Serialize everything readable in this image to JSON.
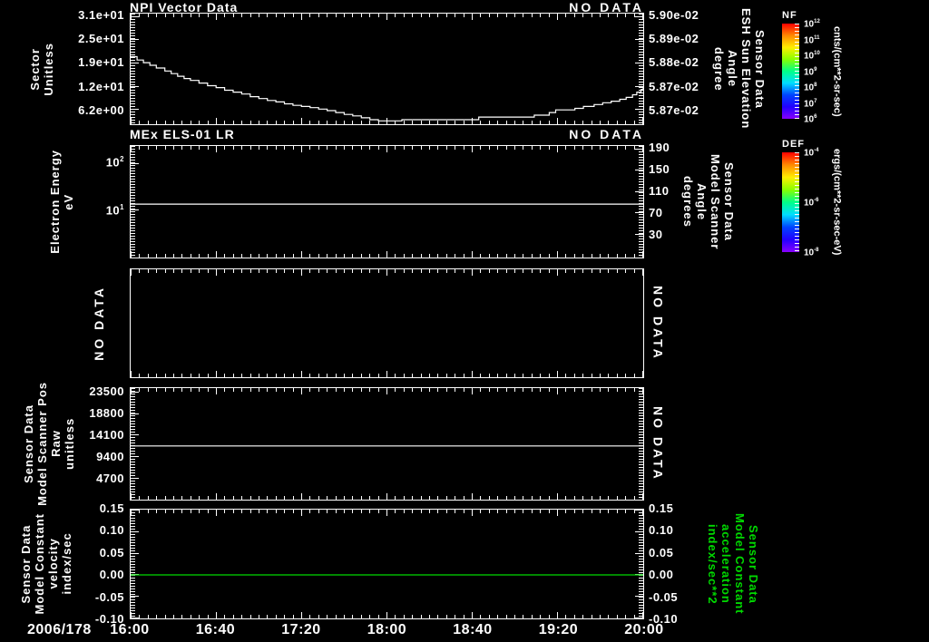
{
  "colors": {
    "background": "#000000",
    "foreground": "#ffffff",
    "green": "#00d900"
  },
  "footer": {
    "date_label": "2006/178",
    "time_ticks": [
      "16:00",
      "16:40",
      "17:20",
      "18:00",
      "18:40",
      "19:20",
      "20:00"
    ]
  },
  "colorbars": [
    {
      "title": "NF",
      "unit": "cnts/(cm**2-sr-sec)",
      "ticks": [
        "10^12",
        "10^11",
        "10^10",
        "10^9",
        "10^8",
        "10^7",
        "10^6"
      ],
      "gradient": [
        "#ff0000",
        "#ff8800",
        "#ffee00",
        "#88ff00",
        "#00ff88",
        "#00ddff",
        "#0044ff",
        "#2200ff",
        "#8800ff"
      ]
    },
    {
      "title": "DEF",
      "unit": "ergs/(cm**2-sr-sec-eV)",
      "ticks": [
        "10^-4",
        "10^-6",
        "10^-8"
      ],
      "gradient": [
        "#ff0000",
        "#ff8800",
        "#ffee00",
        "#88ff00",
        "#00ff88",
        "#00ddff",
        "#0044ff",
        "#2200ff",
        "#8800ff"
      ]
    }
  ],
  "chart_data": [
    {
      "type": "line",
      "title": "NPI Vector Data",
      "status": "NO DATA",
      "ylabel_lines": [
        "Sector",
        "Unitless"
      ],
      "yaxis": {
        "scale": "linear",
        "min": 2.4,
        "max": 31.7,
        "ticks": [
          {
            "v": 31.0,
            "label": "3.1e+01"
          },
          {
            "v": 24.8,
            "label": "2.5e+01"
          },
          {
            "v": 18.6,
            "label": "1.9e+01"
          },
          {
            "v": 12.4,
            "label": "1.2e+01"
          },
          {
            "v": 6.2,
            "label": "6.2e+00"
          }
        ]
      },
      "right_label_lines": [
        "Sensor Data",
        "ESH Sun Elevation",
        "Angle",
        "degree"
      ],
      "right_label_color": "#ffffff",
      "right_axis": {
        "scale": "linear",
        "min": 2.4,
        "max": 31.7,
        "ticks": [
          {
            "v": 31.0,
            "label": "5.90e-02"
          },
          {
            "v": 24.8,
            "label": "5.89e-02"
          },
          {
            "v": 18.6,
            "label": "5.88e-02"
          },
          {
            "v": 12.4,
            "label": "5.87e-02"
          },
          {
            "v": 6.2,
            "label": "5.87e-02"
          }
        ]
      },
      "x_range_minutes": [
        0,
        240
      ],
      "x_start": "16:00",
      "x_end": "20:00",
      "series": [
        {
          "name": "sector",
          "color": "#ffffff",
          "step": true,
          "x_minutes": [
            0,
            3,
            6,
            9,
            12,
            16,
            19,
            22,
            25,
            28,
            32,
            36,
            40,
            44,
            48,
            52,
            56,
            60,
            64,
            68,
            72,
            76,
            80,
            84,
            88,
            92,
            96,
            100,
            104,
            108,
            112,
            116,
            120,
            124,
            127,
            138,
            160,
            163,
            186,
            189,
            196,
            199,
            208,
            212,
            217,
            221,
            225,
            229,
            232,
            235,
            237,
            239,
            240
          ],
          "y": [
            20.3,
            19.4,
            18.7,
            18.0,
            17.3,
            16.5,
            15.8,
            15.1,
            14.5,
            14.0,
            13.3,
            12.6,
            12.1,
            11.4,
            10.9,
            10.4,
            9.7,
            9.2,
            8.7,
            8.3,
            7.8,
            7.4,
            7.1,
            6.8,
            6.4,
            6.0,
            5.5,
            5.0,
            4.6,
            4.1,
            3.6,
            3.3,
            3.3,
            3.3,
            3.6,
            3.6,
            3.6,
            4.3,
            4.3,
            4.8,
            5.5,
            6.2,
            6.6,
            7.1,
            7.6,
            8.1,
            8.5,
            9.0,
            9.5,
            10.2,
            10.9,
            11.6,
            12.1
          ]
        }
      ]
    },
    {
      "type": "line",
      "title": "MEx ELS-01 LR",
      "status": "NO DATA",
      "ylabel_lines": [
        "Electron Energy",
        "eV"
      ],
      "yaxis": {
        "scale": "log",
        "min": 1,
        "max": 230,
        "ticks": [
          {
            "v": 100,
            "label": "10^2"
          },
          {
            "v": 10,
            "label": "10^1"
          }
        ]
      },
      "right_label_lines": [
        "Sensor Data",
        "Model Scanner",
        "Angle",
        "degrees"
      ],
      "right_label_color": "#ffffff",
      "right_axis": {
        "scale": "linear",
        "min": -13,
        "max": 195,
        "ticks": [
          {
            "v": 190,
            "label": "190"
          },
          {
            "v": 150,
            "label": "150"
          },
          {
            "v": 110,
            "label": "110"
          },
          {
            "v": 70,
            "label": "70"
          },
          {
            "v": 30,
            "label": "30"
          }
        ]
      },
      "series": [
        {
          "name": "electron-energy-line",
          "color": "#ffffff",
          "constant_y": 13.5
        }
      ]
    },
    {
      "type": "empty",
      "left_status": "NO DATA",
      "right_status": "NO DATA"
    },
    {
      "type": "line",
      "ylabel_lines": [
        "Sensor Data",
        "Model Scanner Pos",
        "Raw",
        "unitless"
      ],
      "yaxis": {
        "scale": "linear",
        "min": 0,
        "max": 24400,
        "ticks": [
          {
            "v": 23500,
            "label": "23500"
          },
          {
            "v": 18800,
            "label": "18800"
          },
          {
            "v": 14100,
            "label": "14100"
          },
          {
            "v": 9400,
            "label": "9400"
          },
          {
            "v": 4700,
            "label": "4700"
          }
        ]
      },
      "right_status": "NO DATA",
      "series": [
        {
          "name": "scanner-pos",
          "color": "#ffffff",
          "constant_y": 11750
        }
      ]
    },
    {
      "type": "line",
      "ylabel_lines": [
        "Sensor Data",
        "Model Constant",
        "velocity",
        "index/sec"
      ],
      "yaxis": {
        "scale": "linear",
        "min": -0.1,
        "max": 0.15,
        "ticks": [
          {
            "v": 0.15,
            "label": "0.15"
          },
          {
            "v": 0.1,
            "label": "0.10"
          },
          {
            "v": 0.05,
            "label": "0.05"
          },
          {
            "v": 0.0,
            "label": "0.00"
          },
          {
            "v": -0.05,
            "label": "-0.05"
          },
          {
            "v": -0.1,
            "label": "-0.10"
          }
        ]
      },
      "right_label_lines": [
        "Sensor Data",
        "Model Constant",
        "acceleration",
        "index/sec**2"
      ],
      "right_label_color": "#00d900",
      "right_axis": {
        "scale": "linear",
        "min": -0.1,
        "max": 0.15,
        "ticks": [
          {
            "v": 0.15,
            "label": "0.15"
          },
          {
            "v": 0.1,
            "label": "0.10"
          },
          {
            "v": 0.05,
            "label": "0.05"
          },
          {
            "v": 0.0,
            "label": "0.00"
          },
          {
            "v": -0.05,
            "label": "-0.05"
          },
          {
            "v": -0.1,
            "label": "-0.10"
          }
        ]
      },
      "series": [
        {
          "name": "velocity",
          "color": "#00d900",
          "constant_y": 0.0
        }
      ]
    }
  ]
}
